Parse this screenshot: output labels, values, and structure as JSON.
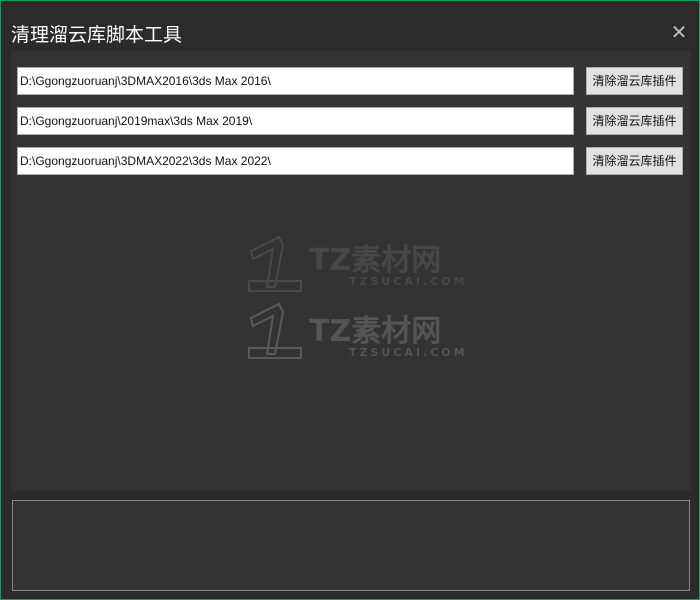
{
  "window": {
    "title": "清理溜云库脚本工具",
    "close_icon": "close-icon"
  },
  "rows": [
    {
      "path": "D:\\Ggongzuoruanj\\3DMAX2016\\3ds Max 2016\\",
      "button": "清除溜云库插件"
    },
    {
      "path": "D:\\Ggongzuoruanj\\2019max\\3ds Max 2019\\",
      "button": "清除溜云库插件"
    },
    {
      "path": "D:\\Ggongzuoruanj\\3DMAX2022\\3ds Max 2022\\",
      "button": "清除溜云库插件"
    }
  ],
  "watermark": {
    "brand": "TZ素材网",
    "site": "TZSUCAI.COM"
  },
  "log": {
    "text": ""
  },
  "colors": {
    "border": "#1f9a5a",
    "background": "#2b2b2b",
    "panel": "#333333"
  }
}
